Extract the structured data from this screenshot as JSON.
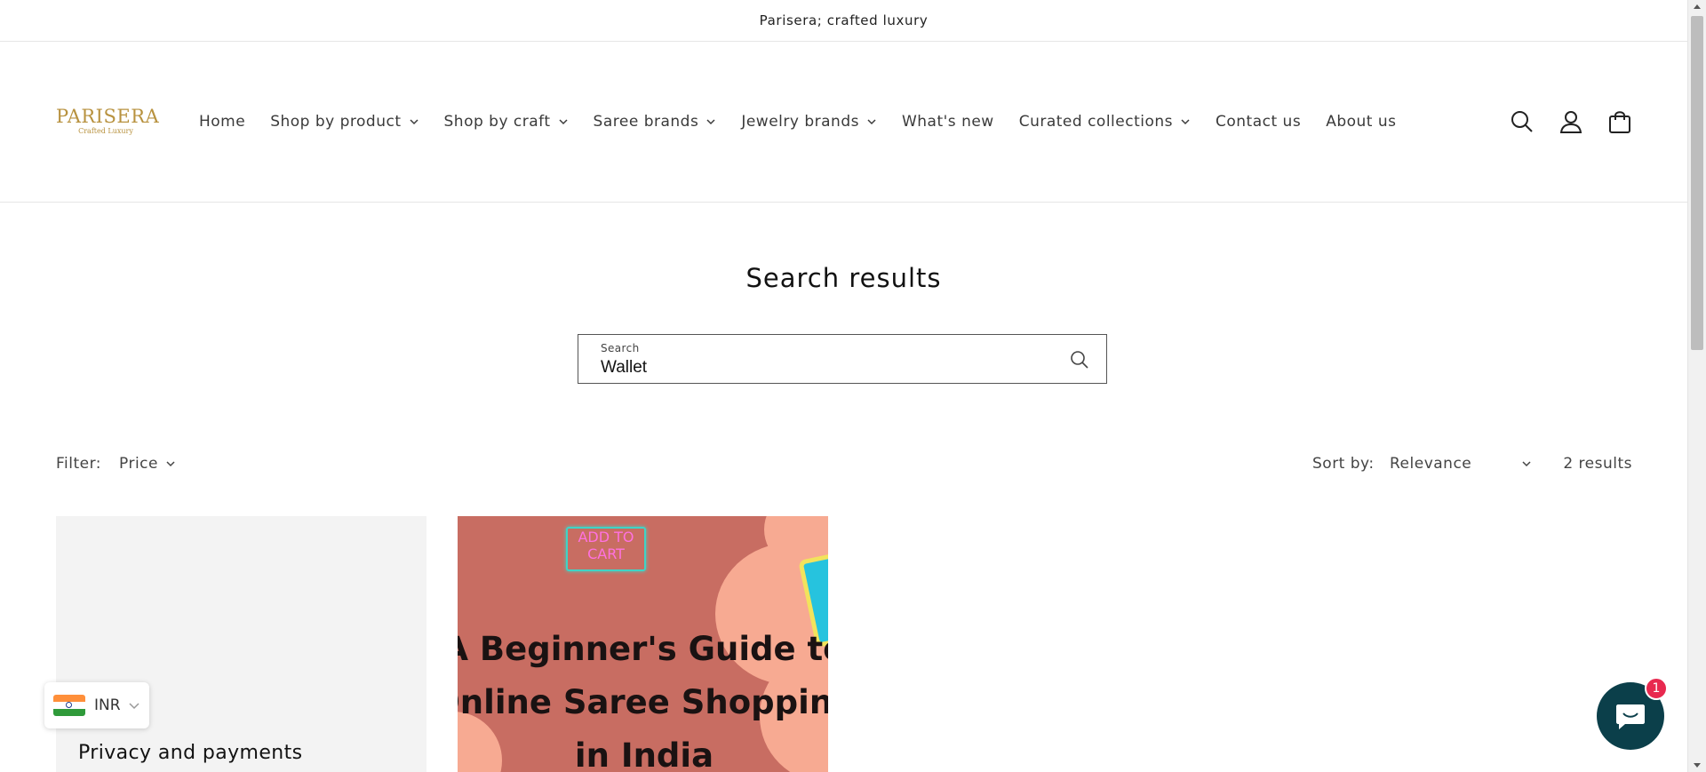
{
  "announcement": "Parisera; crafted luxury",
  "logo": {
    "title": "PARISERA",
    "tagline": "Crafted Luxury"
  },
  "nav": [
    {
      "label": "Home",
      "dropdown": false
    },
    {
      "label": "Shop by product",
      "dropdown": true
    },
    {
      "label": "Shop by craft",
      "dropdown": true
    },
    {
      "label": "Saree brands",
      "dropdown": true
    },
    {
      "label": "Jewelry brands",
      "dropdown": true
    },
    {
      "label": "What's new",
      "dropdown": false
    },
    {
      "label": "Curated collections",
      "dropdown": true
    },
    {
      "label": "Contact us",
      "dropdown": false
    },
    {
      "label": "About us",
      "dropdown": false
    }
  ],
  "header_icons": [
    "search-icon",
    "account-icon",
    "cart-icon"
  ],
  "main": {
    "title": "Search results",
    "search": {
      "label": "Search",
      "value": "Wallet"
    }
  },
  "filters": {
    "filter_label": "Filter:",
    "price_label": "Price",
    "sort_label": "Sort by:",
    "sort_value": "Relevance",
    "results_count": "2 results"
  },
  "results": [
    {
      "title": "Privacy and payments"
    },
    {
      "image_text": {
        "badge_line1": "ADD TO",
        "badge_line2": "CART",
        "line1": "A Beginner's Guide to",
        "line2": "Online Saree Shopping",
        "line3": "in India"
      }
    }
  ],
  "currency": {
    "code": "INR"
  },
  "chat": {
    "badge": "1"
  },
  "colors": {
    "logo": "#b8923f",
    "card_bg": "#c86d62",
    "blob": "#f7aa92",
    "chat": "#0b3f4a",
    "badge": "#e8294f"
  }
}
